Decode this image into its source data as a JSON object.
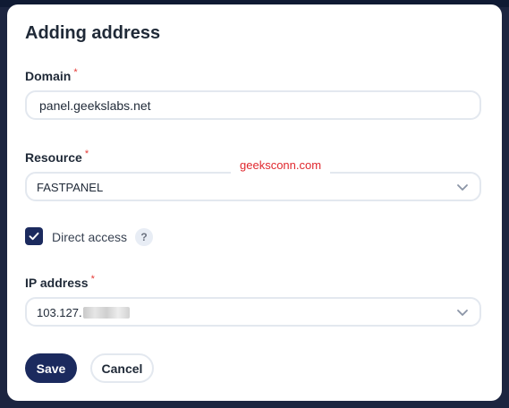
{
  "dialog": {
    "title": "Adding address"
  },
  "domain": {
    "label": "Domain",
    "required_mark": "*",
    "value": "panel.geekslabs.net"
  },
  "resource": {
    "label": "Resource",
    "required_mark": "*",
    "selected": "FASTPANEL"
  },
  "watermark": {
    "text": "geeksconn.com",
    "color": "#e0282e"
  },
  "direct_access": {
    "label": "Direct access",
    "checked": true,
    "help": "?"
  },
  "ip_address": {
    "label": "IP address",
    "required_mark": "*",
    "selected_visible": "103.127."
  },
  "actions": {
    "save_label": "Save",
    "cancel_label": "Cancel"
  },
  "colors": {
    "primary": "#1b2a5e",
    "required": "#e53935",
    "border": "#e3e8ef"
  },
  "icons": {
    "select_indicator": "chevron-down-icon",
    "checkbox": "check-icon",
    "help": "question-icon"
  }
}
